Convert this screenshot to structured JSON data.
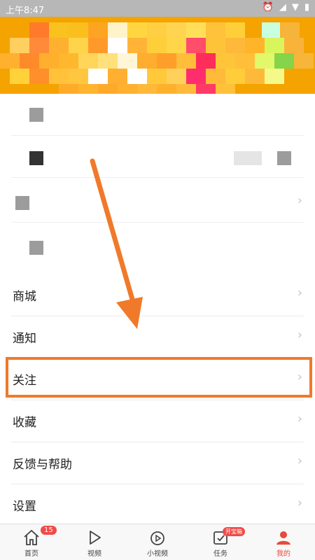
{
  "status": {
    "time": "上午8:47"
  },
  "menu": [
    {
      "label": "商城"
    },
    {
      "label": "通知"
    },
    {
      "label": "关注"
    },
    {
      "label": "收藏"
    },
    {
      "label": "反馈与帮助"
    },
    {
      "label": "设置"
    }
  ],
  "tabbar": [
    {
      "label": "首页",
      "badge": "15"
    },
    {
      "label": "视频"
    },
    {
      "label": "小视频"
    },
    {
      "label": "任务",
      "badge": "开宝箱"
    },
    {
      "label": "我的"
    }
  ],
  "colors": {
    "accent": "#f07a2a",
    "active": "#e84a3b",
    "header": "#f4a300"
  }
}
